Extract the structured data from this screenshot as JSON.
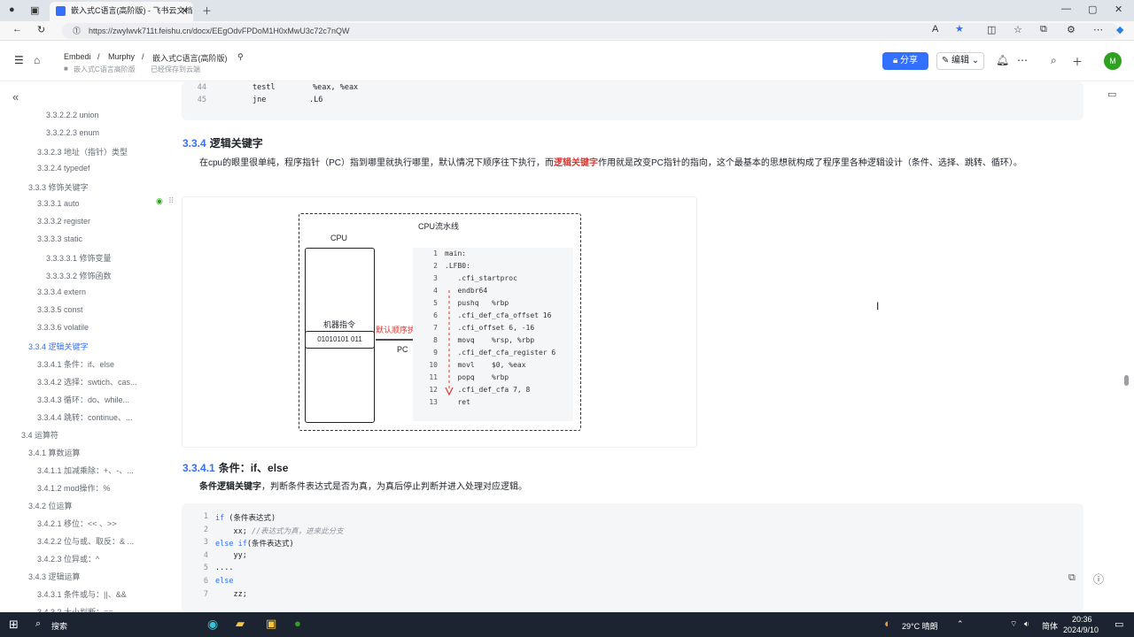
{
  "browser": {
    "tab_title": "嵌入式C语言(高阶版) - 飞书云文档",
    "url": "https://zwylwvk711t.feishu.cn/docx/EEgOdvFPDoM1H0xMwU3c72c7nQW"
  },
  "header": {
    "crumb1": "Embedi",
    "crumb2": "Murphy",
    "crumb3": "嵌入式C语言(高阶版)",
    "sub1": "嵌入式C语言高阶版",
    "sub2": "已经保存到云端",
    "share_label": "分享",
    "edit_label": "编辑",
    "avatar_letter": "M",
    "accent": "#3370ff"
  },
  "sidebar": {
    "items": [
      {
        "label": "3.3.2.2.2 union",
        "active": false
      },
      {
        "label": "3.3.2.2.3 enum",
        "active": false
      },
      {
        "label": "3.3.2.3 地址（指针）类型",
        "active": false
      },
      {
        "label": "3.3.2.4 typedef",
        "active": false
      },
      {
        "label": "3.3.3 修饰关键字",
        "active": false
      },
      {
        "label": "3.3.3.1 auto",
        "active": false
      },
      {
        "label": "3.3.3.2 register",
        "active": false
      },
      {
        "label": "3.3.3.3 static",
        "active": false
      },
      {
        "label": "3.3.3.3.1 修饰变量",
        "active": false
      },
      {
        "label": "3.3.3.3.2 修饰函数",
        "active": false
      },
      {
        "label": "3.3.3.4 extern",
        "active": false
      },
      {
        "label": "3.3.3.5 const",
        "active": false
      },
      {
        "label": "3.3.3.6 volatile",
        "active": false
      },
      {
        "label": "3.3.4 逻辑关键字",
        "active": true
      },
      {
        "label": "3.3.4.1 条件：if、else",
        "active": false
      },
      {
        "label": "3.3.4.2 选择：swtich、cas...",
        "active": false
      },
      {
        "label": "3.3.4.3 循环：do、while...",
        "active": false
      },
      {
        "label": "3.3.4.4 跳转：continue、...",
        "active": false
      },
      {
        "label": "3.4 运算符",
        "active": false
      },
      {
        "label": "3.4.1 算数运算",
        "active": false
      },
      {
        "label": "3.4.1.1 加减乘除：+、-、...",
        "active": false
      },
      {
        "label": "3.4.1.2 mod操作：%",
        "active": false
      },
      {
        "label": "3.4.2 位运算",
        "active": false
      },
      {
        "label": "3.4.2.1 移位：<< 、>>",
        "active": false
      },
      {
        "label": "3.4.2.2 位与或、取反：& ...",
        "active": false
      },
      {
        "label": "3.4.2.3 位异或：^",
        "active": false
      },
      {
        "label": "3.4.3 逻辑运算",
        "active": false
      },
      {
        "label": "3.4.3.1 条件或与：||、&&",
        "active": false
      },
      {
        "label": "3.4.3.2 大小判断：==、...",
        "active": false
      }
    ]
  },
  "top_code": {
    "lines": [
      {
        "n": "44",
        "op": "testl",
        "args": "%eax, %eax"
      },
      {
        "n": "45",
        "op": "jne",
        "args": ".L6"
      }
    ]
  },
  "section": {
    "num": "3.3.4",
    "title": "逻辑关键字",
    "para_pre": "在cpu的眼里很单纯，程序指针（PC）指到哪里就执行哪里，默认情况下顺序往下执行，而",
    "para_red": "逻辑关键字",
    "para_post": "作用就是改变PC指针的指向，这个最基本的思想就构成了程序里各种逻辑设计（条件、选择、跳转、循环）。"
  },
  "diagram": {
    "pipeline_label": "CPU流水线",
    "cpu_label": "CPU",
    "instr_label": "机器指令",
    "instr_bits": "01010101 011",
    "default_exec": "默认顺序执行",
    "pc_label": "PC",
    "code": [
      {
        "n": "1",
        "t": "main:"
      },
      {
        "n": "2",
        "t": ".LFB0:"
      },
      {
        "n": "3",
        "t": "   .cfi_startproc"
      },
      {
        "n": "4",
        "t": "   endbr64"
      },
      {
        "n": "5",
        "t": "   pushq   %rbp"
      },
      {
        "n": "6",
        "t": "   .cfi_def_cfa_offset 16"
      },
      {
        "n": "7",
        "t": "   .cfi_offset 6, -16"
      },
      {
        "n": "8",
        "t": "   movq    %rsp, %rbp"
      },
      {
        "n": "9",
        "t": "   .cfi_def_cfa_register 6"
      },
      {
        "n": "10",
        "t": "   movl    $0, %eax"
      },
      {
        "n": "11",
        "t": "   popq    %rbp"
      },
      {
        "n": "12",
        "t": "   .cfi_def_cfa 7, 8"
      },
      {
        "n": "13",
        "t": "   ret"
      }
    ]
  },
  "subsection": {
    "num": "3.3.4.1",
    "title": "条件：if、else",
    "para_bold": "条件逻辑关键字",
    "para_rest": "，判断条件表达式是否为真，为真后停止判断并进入处理对应逻辑。"
  },
  "bottom_code": {
    "lines": [
      {
        "n": "1",
        "kw": "if",
        "rest": " (条件表达式)",
        "comment": ""
      },
      {
        "n": "2",
        "kw": "",
        "rest": "    xx;",
        "comment": " //表达式为真，进来此分支"
      },
      {
        "n": "3",
        "kw": "else if",
        "rest": "(条件表达式)",
        "comment": ""
      },
      {
        "n": "4",
        "kw": "",
        "rest": "    yy;",
        "comment": ""
      },
      {
        "n": "5",
        "kw": "",
        "rest": "....",
        "comment": ""
      },
      {
        "n": "6",
        "kw": "else",
        "rest": "",
        "comment": ""
      },
      {
        "n": "7",
        "kw": "",
        "rest": "    zz;",
        "comment": ""
      }
    ]
  },
  "taskbar": {
    "search": "搜索",
    "weather": "29°C 晴朗",
    "lang": "简体",
    "time": "20:36",
    "date": "2024/9/10"
  }
}
